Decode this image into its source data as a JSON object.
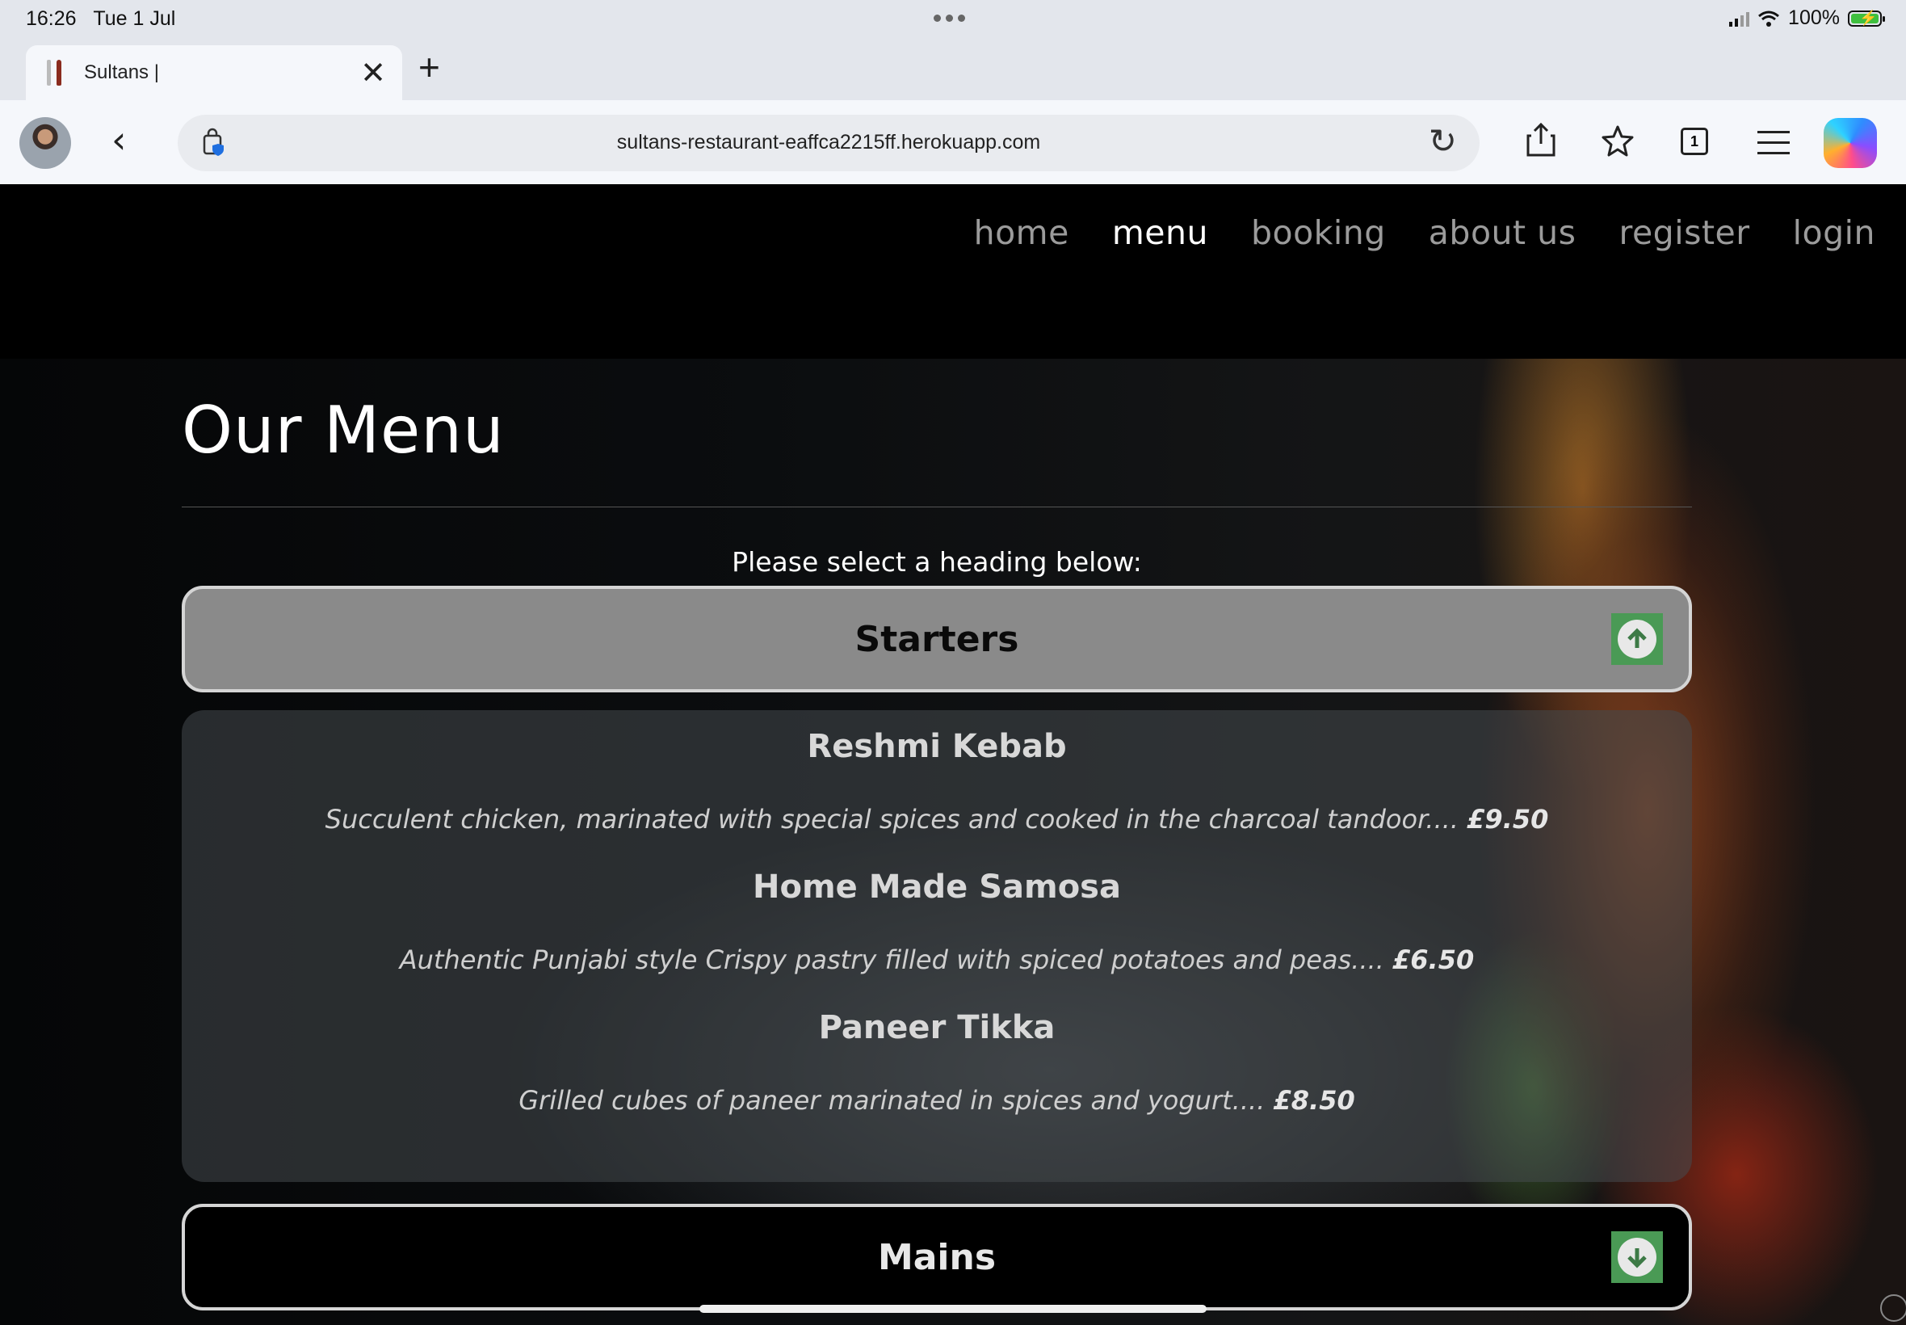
{
  "status_bar": {
    "time": "16:26",
    "date": "Tue 1 Jul",
    "battery": "100%"
  },
  "browser": {
    "tab_title": "Sultans |",
    "url": "sultans-restaurant-eaffca2215ff.herokuapp.com",
    "tabs_count": "1"
  },
  "nav": {
    "items": [
      {
        "label": "home",
        "active": false
      },
      {
        "label": "menu",
        "active": true
      },
      {
        "label": "booking",
        "active": false
      },
      {
        "label": "about us",
        "active": false
      },
      {
        "label": "register",
        "active": false
      },
      {
        "label": "login",
        "active": false
      }
    ]
  },
  "main": {
    "title": "Our Menu",
    "instruction": "Please select a heading below:",
    "sections": [
      {
        "title": "Starters",
        "expanded": true,
        "items": [
          {
            "name": "Reshmi Kebab",
            "description": "Succulent chicken, marinated with special spices and cooked in the charcoal tandoor....",
            "price": "£9.50"
          },
          {
            "name": "Home Made Samosa",
            "description": "Authentic Punjabi style Crispy pastry filled with spiced potatoes and peas....",
            "price": "£6.50"
          },
          {
            "name": "Paneer Tikka",
            "description": "Grilled cubes of paneer marinated in spices and yogurt....",
            "price": "£8.50"
          }
        ]
      },
      {
        "title": "Mains",
        "expanded": false,
        "items": []
      }
    ]
  },
  "colors": {
    "toggle_green": "#4a9a55",
    "open_header_bg": "#8a8a8a",
    "nav_inactive": "#9b9b9b"
  }
}
